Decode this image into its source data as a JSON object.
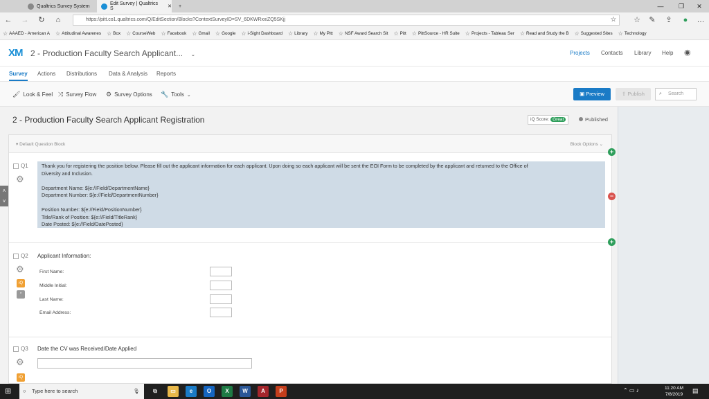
{
  "browser": {
    "tabs": [
      {
        "label": "Qualtrics Survey System",
        "active": false
      },
      {
        "label": "Edit Survey | Qualtrics S",
        "active": true
      }
    ],
    "url": "https://pitt.co1.qualtrics.com/Q/EditSection/Blocks?ContextSurveyID=SV_6DKWRxxiZQ5SKjj",
    "bookmarks": [
      "AAAED - American A",
      "Attitudinal Awarenes",
      "Box",
      "CourseWeb",
      "Facebook",
      "Gmail",
      "Google",
      "i-Sight Dashboard",
      "Library",
      "My Pitt",
      "NSF Award Search Sit",
      "Pitt",
      "PittSource - HR Suite",
      "Projects - Tableau Ser",
      "Read and Study the B",
      "Suggested Sites",
      "Technology"
    ]
  },
  "header": {
    "logo": "XM",
    "survey_title": "2 - Production Faculty Search Applicant...",
    "nav": [
      "Projects",
      "Contacts",
      "Library",
      "Help"
    ]
  },
  "survey_tabs": [
    "Survey",
    "Actions",
    "Distributions",
    "Data & Analysis",
    "Reports"
  ],
  "toolbar": {
    "look_feel": "Look & Feel",
    "survey_flow": "Survey Flow",
    "survey_options": "Survey Options",
    "tools": "Tools",
    "preview": "Preview",
    "publish": "Publish",
    "search_placeholder": "Search"
  },
  "page": {
    "title": "2 - Production Faculty Search Applicant Registration",
    "iq_score_label": "iQ Score:",
    "iq_score_value": "Great",
    "status": "Published"
  },
  "block": {
    "name": "Default Question Block",
    "options_label": "Block Options"
  },
  "questions": {
    "q1": {
      "number": "Q1",
      "lines": [
        "Thank you for registering the position below.  Please fill out the applicant information for each applicant.  Upon doing so each applicant will be sent the EOI Form to be completed by the applicant and returned to the Office of",
        "Diversity and Inclusion.",
        "",
        "Department Name: ${e://Field/DepartmentName}",
        "Department Number: ${e://Field/DepartmentNumber}",
        "",
        "Position Number: ${e://Field/PositionNumber}",
        "Title/Rank of Position: ${e://Field/TitleRank}",
        "Date Posted: ${e://Field/DatePosted}"
      ]
    },
    "q2": {
      "number": "Q2",
      "title": "Applicant Information:",
      "fields": [
        "First Name:",
        "Middle Initial:",
        "Last Name:",
        "Email Address:"
      ]
    },
    "q3": {
      "number": "Q3",
      "title": "Date the CV was Received/Date Applied"
    }
  },
  "taskbar": {
    "search_placeholder": "Type here to search",
    "time": "11:20 AM",
    "date": "7/8/2019"
  }
}
